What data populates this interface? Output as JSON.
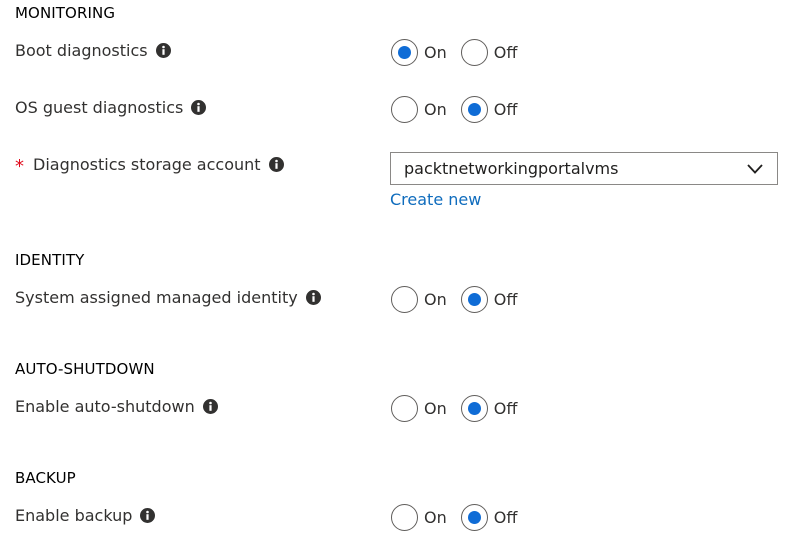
{
  "sections": {
    "monitoring": "MONITORING",
    "identity": "IDENTITY",
    "auto_shutdown": "AUTO-SHUTDOWN",
    "backup": "BACKUP"
  },
  "fields": {
    "boot_diagnostics": {
      "label": "Boot diagnostics",
      "on": "On",
      "off": "Off",
      "selected": "On"
    },
    "os_guest_diagnostics": {
      "label": "OS guest diagnostics",
      "on": "On",
      "off": "Off",
      "selected": "Off"
    },
    "diagnostics_storage": {
      "required_mark": "*",
      "label": "Diagnostics storage account",
      "value": "packtnetworkingportalvms",
      "create_new": "Create new"
    },
    "system_identity": {
      "label": "System assigned managed identity",
      "on": "On",
      "off": "Off",
      "selected": "Off"
    },
    "auto_shutdown": {
      "label": "Enable auto-shutdown",
      "on": "On",
      "off": "Off",
      "selected": "Off"
    },
    "backup": {
      "label": "Enable backup",
      "on": "On",
      "off": "Off",
      "selected": "Off"
    }
  },
  "icons": {
    "info": "info-icon",
    "dropdown": "chevron-down-icon"
  },
  "colors": {
    "accent": "#0f6cd6",
    "link": "#0f6cbd",
    "required": "#e00b1c",
    "text": "#323130"
  }
}
